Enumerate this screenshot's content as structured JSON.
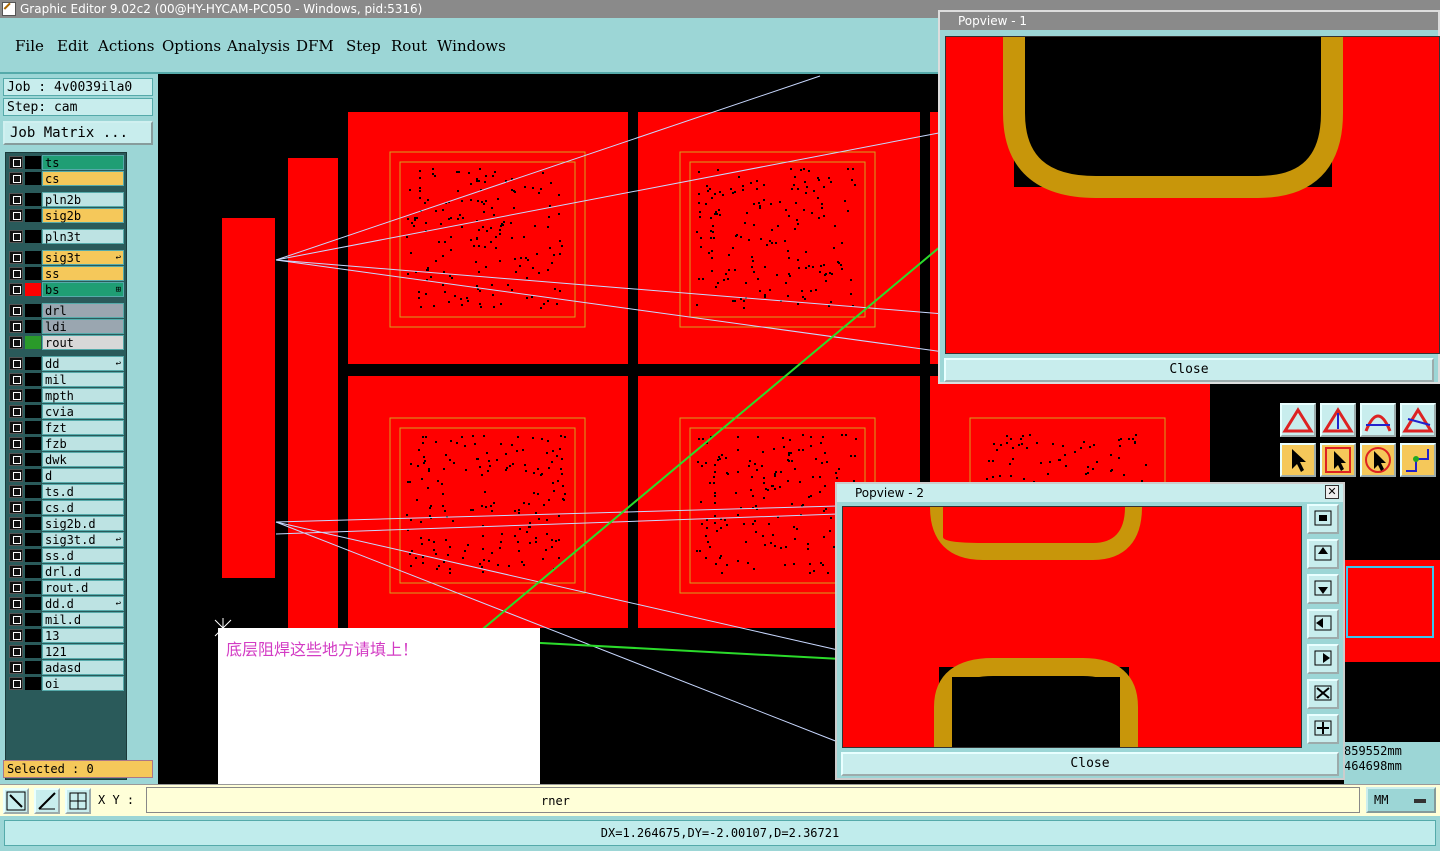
{
  "window": {
    "title": "Graphic Editor 9.02c2 (00@HY-HYCAM-PC050 - Windows, pid:5316)"
  },
  "menu": [
    "File",
    "Edit",
    "Actions",
    "Options",
    "Analysis",
    "DFM",
    "Step",
    "Rout",
    "Windows"
  ],
  "sidebar": {
    "job": "Job : 4v0039ila0",
    "step": "Step: cam",
    "job_matrix": "Job Matrix ...",
    "selected": "Selected : 0",
    "layers": [
      {
        "name": "ts",
        "color": "#1f9e74",
        "mark": ""
      },
      {
        "name": "cs",
        "color": "#f5c85a",
        "mark": ""
      },
      {
        "name": "pln2b",
        "color": "#bde3e3",
        "mark": ""
      },
      {
        "name": "sig2b",
        "color": "#f5c85a",
        "mark": ""
      },
      {
        "name": "pln3t",
        "color": "#bde3e3",
        "mark": ""
      },
      {
        "name": "sig3t",
        "color": "#f5c85a",
        "mark": "↩"
      },
      {
        "name": "ss",
        "color": "#f5c85a",
        "mark": ""
      },
      {
        "name": "bs",
        "color": "#1f9e74",
        "mark": "⊞"
      },
      {
        "name": "drl",
        "color": "#9aa6b0",
        "mark": ""
      },
      {
        "name": "ldi",
        "color": "#9aa6b0",
        "mark": ""
      },
      {
        "name": "rout",
        "color": "#d8d8d8",
        "mark": ""
      },
      {
        "name": "dd",
        "color": "#bde3e3",
        "mark": "↩"
      },
      {
        "name": "mil",
        "color": "#bde3e3",
        "mark": ""
      },
      {
        "name": "mpth",
        "color": "#bde3e3",
        "mark": ""
      },
      {
        "name": "cvia",
        "color": "#bde3e3",
        "mark": ""
      },
      {
        "name": "fzt",
        "color": "#bde3e3",
        "mark": ""
      },
      {
        "name": "fzb",
        "color": "#bde3e3",
        "mark": ""
      },
      {
        "name": "dwk",
        "color": "#bde3e3",
        "mark": ""
      },
      {
        "name": "d",
        "color": "#bde3e3",
        "mark": ""
      },
      {
        "name": "ts.d",
        "color": "#bde3e3",
        "mark": ""
      },
      {
        "name": "cs.d",
        "color": "#bde3e3",
        "mark": ""
      },
      {
        "name": "sig2b.d",
        "color": "#bde3e3",
        "mark": ""
      },
      {
        "name": "sig3t.d",
        "color": "#bde3e3",
        "mark": "↩"
      },
      {
        "name": "ss.d",
        "color": "#bde3e3",
        "mark": ""
      },
      {
        "name": "drl.d",
        "color": "#bde3e3",
        "mark": ""
      },
      {
        "name": "rout.d",
        "color": "#bde3e3",
        "mark": ""
      },
      {
        "name": "dd.d",
        "color": "#bde3e3",
        "mark": "↩"
      },
      {
        "name": "mil.d",
        "color": "#bde3e3",
        "mark": ""
      },
      {
        "name": "13",
        "color": "#bde3e3",
        "mark": ""
      },
      {
        "name": "121",
        "color": "#bde3e3",
        "mark": ""
      },
      {
        "name": "adasd",
        "color": "#bde3e3",
        "mark": ""
      },
      {
        "name": "oi",
        "color": "#bde3e3",
        "mark": ""
      }
    ]
  },
  "annotation": "底层阻焊这些地方请填上！",
  "popview1": {
    "title": "Popview - 1",
    "close": "Close"
  },
  "popview2": {
    "title": "Popview - 2",
    "close": "Close"
  },
  "bottom": {
    "xy_label": "X Y :",
    "hint": "rner",
    "units": "MM"
  },
  "coords": {
    "line1": "859552mm",
    "line2": "464698mm"
  },
  "status": "DX=1.264675,DY=-2.00107,D=2.36721",
  "colors": {
    "board": "#ff0000",
    "pad": "#c8960a",
    "accent": "#9cd6d6",
    "arrow": "#2bdb2b"
  }
}
